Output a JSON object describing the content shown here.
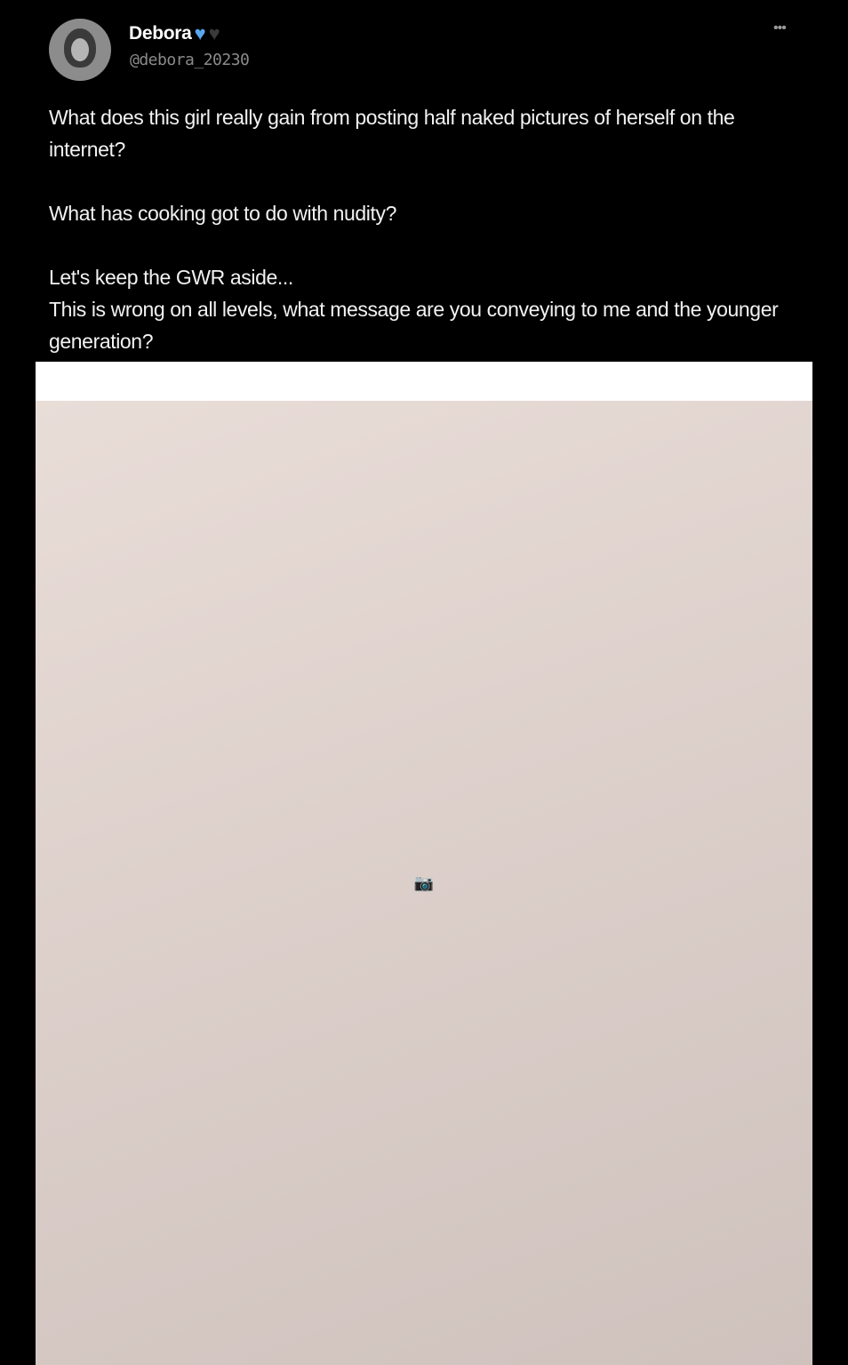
{
  "tweet": {
    "display_name": "Debora",
    "badges": [
      "blue-heart-icon",
      "black-heart-icon"
    ],
    "handle": "@debora_20230",
    "more_icon": "more-icon",
    "paragraphs": [
      "What does this girl really gain from posting half naked pictures of herself on the internet?",
      "What has cooking got to do with nudity?",
      "Let's keep the GWR aside...",
      "This is wrong on all levels, what message are you conveying to me and the younger generation?"
    ]
  },
  "colors": {
    "background": "#000000",
    "text": "#f2f2f2",
    "handle": "#8b8b8b",
    "badge_blue": "#59a7ef"
  }
}
